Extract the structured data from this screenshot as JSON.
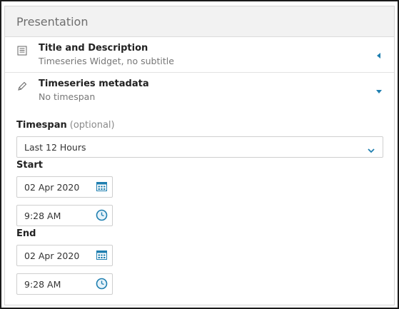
{
  "panel": {
    "title": "Presentation"
  },
  "sections": [
    {
      "title": "Title and Description",
      "subtitle": "Timeseries Widget, no subtitle",
      "icon": "list-icon",
      "state": "collapsed"
    },
    {
      "title": "Timeseries metadata",
      "subtitle": "No timespan",
      "icon": "pencil-icon",
      "state": "expanded"
    }
  ],
  "timespan": {
    "label": "Timespan",
    "optional": "(optional)",
    "value": "Last 12 Hours"
  },
  "start": {
    "label": "Start",
    "date": "02 Apr 2020",
    "time": "9:28 AM"
  },
  "end": {
    "label": "End",
    "date": "02 Apr 2020",
    "time": "9:28 AM"
  },
  "colors": {
    "accent": "#1f7fb0",
    "header_bg": "#f2f2f2",
    "border": "#cfcfcf"
  }
}
